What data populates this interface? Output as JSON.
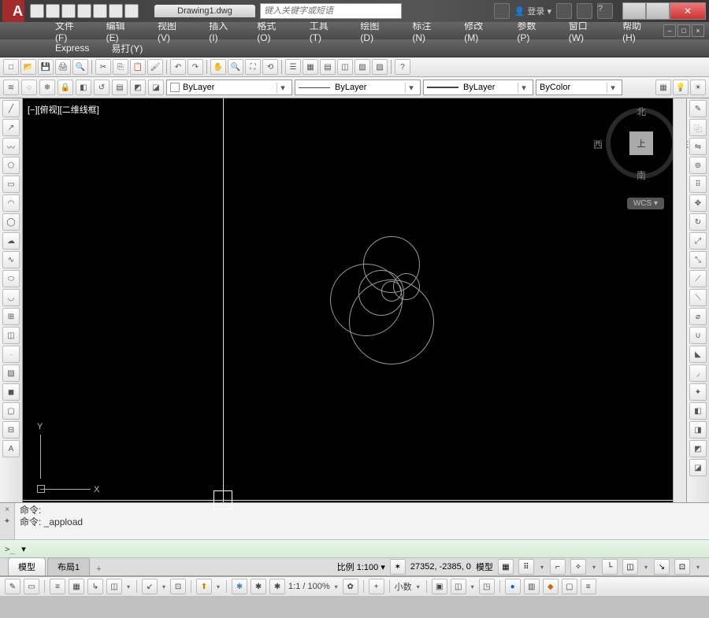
{
  "title": {
    "logo": "A",
    "document": "Drawing1.dwg",
    "search_placeholder": "键入关键字或短语",
    "login": "登录"
  },
  "window_controls": {
    "min": "—",
    "max": "□",
    "close": "✕"
  },
  "menus": [
    "文件(F)",
    "编辑(E)",
    "视图(V)",
    "插入(I)",
    "格式(O)",
    "工具(T)",
    "绘图(D)",
    "标注(N)",
    "修改(M)",
    "参数(P)",
    "窗口(W)",
    "帮助(H)"
  ],
  "menus2": [
    "Express",
    "易打(Y)"
  ],
  "props": {
    "layer": "ByLayer",
    "color_label": "ByLayer",
    "linetype_label": "ByLayer",
    "plotstyle": "ByColor"
  },
  "viewport": {
    "label": "[−][俯视][二维线框]",
    "wcs": "WCS",
    "compass": {
      "n": "北",
      "s": "南",
      "e": "东",
      "w": "西",
      "top": "上"
    },
    "axes": {
      "x": "X",
      "y": "Y"
    }
  },
  "command": {
    "line1": "命令:",
    "line2": "命令: _appload",
    "prompt": ">_"
  },
  "tabs": {
    "model": "模型",
    "layout1": "布局1",
    "add": "+"
  },
  "status": {
    "scale_label": "比例 1:100",
    "coord": "27352, -2385, 0",
    "model": "模型",
    "one_to_one": "1:1 / 100%",
    "decimal": "小数",
    "bar2_icons": [
      ""
    ]
  }
}
